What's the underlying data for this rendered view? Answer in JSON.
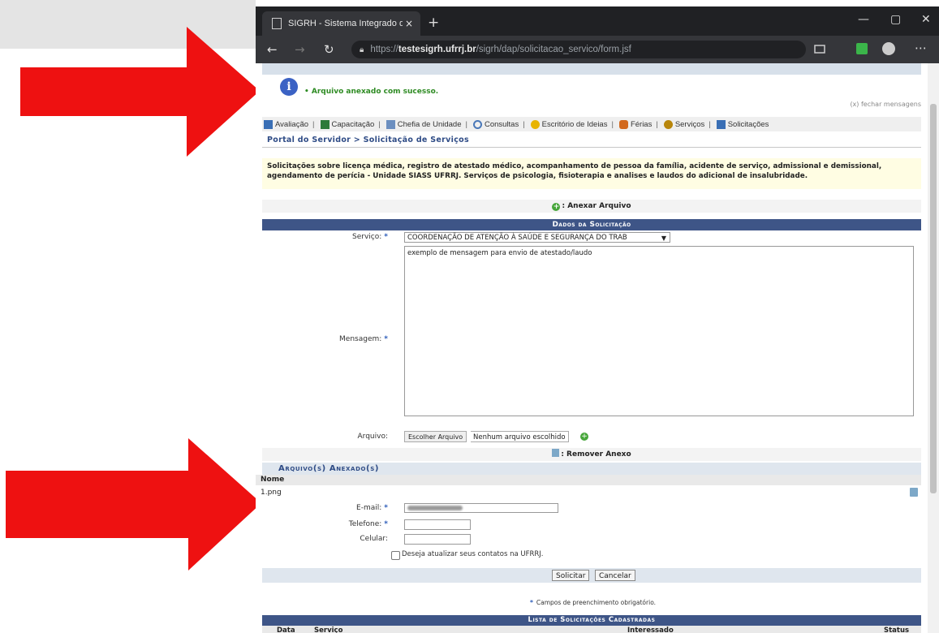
{
  "browser": {
    "tab_title": "SIGRH - Sistema Integrado de G",
    "tab_close": "×",
    "new_tab": "+",
    "url_prefix": "https://",
    "url_host": "testesigrh.ufrrj.br",
    "url_path": "/sigrh/dap/solicitacao_servico/form.jsf",
    "window_min": "—",
    "window_max": "▢",
    "window_close": "✕"
  },
  "message": {
    "text": "• Arquivo anexado com sucesso.",
    "close": "(x) fechar mensagens"
  },
  "menu": {
    "items": [
      {
        "label": "Avaliação",
        "icon": "evaluation-icon",
        "color": "#3a6fb5"
      },
      {
        "label": "Capacitação",
        "icon": "training-icon",
        "color": "#2d7a3a"
      },
      {
        "label": "Chefia de Unidade",
        "icon": "unit-head-icon",
        "color": "#6c8fc0"
      },
      {
        "label": "Consultas",
        "icon": "search-icon",
        "color": "#4a78b8"
      },
      {
        "label": "Escritório de Ideias",
        "icon": "lightbulb-icon",
        "color": "#e8b400"
      },
      {
        "label": "Férias",
        "icon": "vacation-icon",
        "color": "#d2691e"
      },
      {
        "label": "Serviços",
        "icon": "services-icon",
        "color": "#b8860b"
      },
      {
        "label": "Solicitações",
        "icon": "requests-icon",
        "color": "#3a6fb5"
      }
    ],
    "separator": "|"
  },
  "breadcrumb": "Portal do Servidor > Solicitação de Serviços",
  "notice": "Solicitações sobre licença médica, registro de atestado médico, acompanhamento de pessoa da família, acidente de serviço, admissional e demissional, agendamento de perícia - Unidade SIASS UFRRJ. Serviços de psicologia, fisioterapia e analises e laudos do adicional de insalubridade.",
  "anexar_label": ": Anexar Arquivo",
  "dados_header": "Dados da Solicitação",
  "form": {
    "servico_label": "Serviço:",
    "servico_value": "COORDENAÇÃO DE ATENÇÃO À SAÚDE E SEGURANÇA DO TRAB",
    "mensagem_label": "Mensagem:",
    "mensagem_value": "exemplo de mensagem para envio de atestado/laudo",
    "arquivo_label": "Arquivo:",
    "file_button": "Escolher Arquivo",
    "file_status": "Nenhum arquivo escolhido",
    "required_mark": "*"
  },
  "remover_label": ": Remover Anexo",
  "anexados_header": "Arquivo(s) Anexado(s)",
  "nome_header": "Nome",
  "attached_file": "1.png",
  "contact": {
    "email_label": "E-mail:",
    "telefone_label": "Telefone:",
    "celular_label": "Celular:",
    "update_label": "Deseja atualizar seus contatos na UFRRJ."
  },
  "buttons": {
    "solicitar": "Solicitar",
    "cancelar": "Cancelar"
  },
  "campos_note": "Campos de preenchimento obrigatório.",
  "lista_header": "Lista de Solicitações Cadastradas",
  "lista_columns": {
    "data": "Data",
    "servico": "Serviço",
    "interessado": "Interessado",
    "status": "Status"
  },
  "colors": {
    "arrow": "#ee1111",
    "header_blue": "#3e5587",
    "success_green": "#2e8b23"
  }
}
